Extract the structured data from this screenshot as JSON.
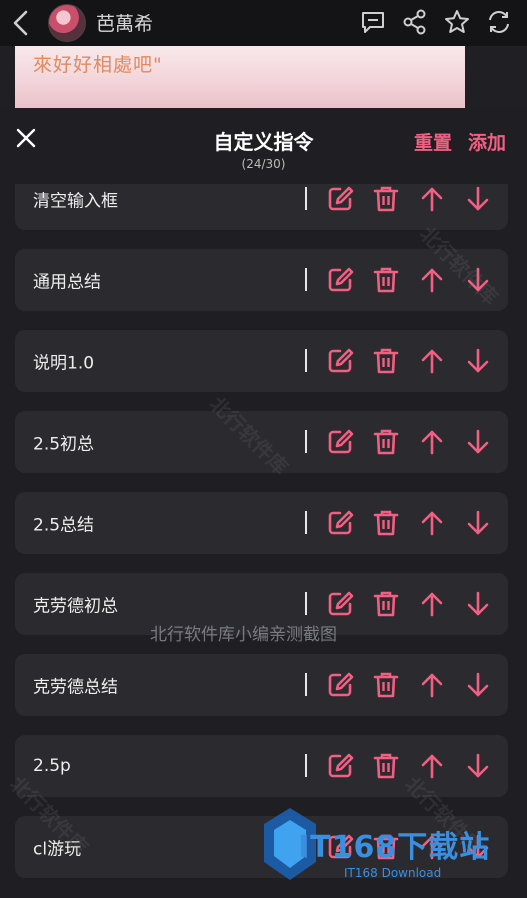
{
  "topbar": {
    "title": "芭萬希",
    "icons": [
      "back-icon",
      "avatar",
      "comment-icon",
      "share-icon",
      "star-icon",
      "refresh-icon"
    ]
  },
  "background_text": "來好好相處吧\"",
  "sheet": {
    "title": "自定义指令",
    "count": "(24/30)",
    "reset_label": "重置",
    "add_label": "添加",
    "accent_color": "#f25f82"
  },
  "commands": [
    {
      "label": "清空输入框"
    },
    {
      "label": "通用总结"
    },
    {
      "label": "说明1.0"
    },
    {
      "label": "2.5初总"
    },
    {
      "label": "2.5总结"
    },
    {
      "label": "克劳德初总"
    },
    {
      "label": "克劳德总结"
    },
    {
      "label": "2.5p"
    },
    {
      "label": "cl游玩"
    }
  ],
  "watermark": {
    "caption": "北行软件库小编亲测截图",
    "diagonal": "北行软件库",
    "logo_main": "IT168下载站",
    "logo_sub": "IT168 Download"
  }
}
